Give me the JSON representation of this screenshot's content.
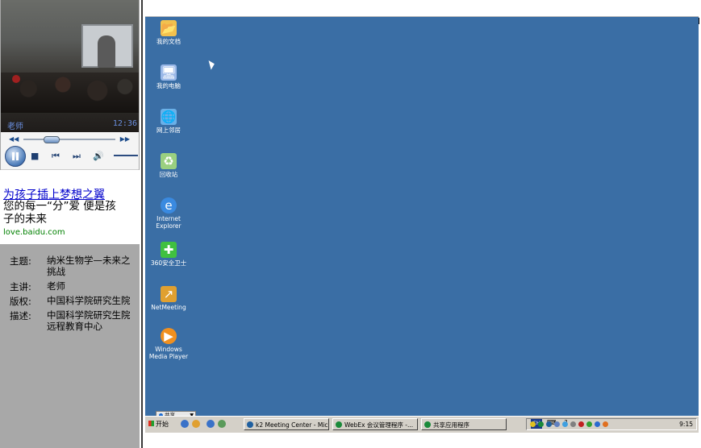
{
  "video": {
    "speaker_label": "老师",
    "time": "12:36"
  },
  "ad": {
    "title": "为孩子插上梦想之翼",
    "desc": "您的每一“分”爱 便是孩子的未来",
    "url": "love.baidu.com"
  },
  "info": [
    {
      "key": "主题:",
      "value": "纳米生物学—未来之挑战"
    },
    {
      "key": "主讲:",
      "value": "老师"
    },
    {
      "key": "版权:",
      "value": "中国科学院研究生院"
    },
    {
      "key": "描述:",
      "value": "中国科学院研究生院远程教育中心"
    }
  ],
  "desktop_icons": [
    {
      "label": "我的文档",
      "icon": "folder-icon",
      "color": "#f2c14e"
    },
    {
      "label": "我的电脑",
      "icon": "computer-icon",
      "color": "#9ab8e8"
    },
    {
      "label": "网上邻居",
      "icon": "network-icon",
      "color": "#6ab0e8"
    },
    {
      "label": "回收站",
      "icon": "recycle-bin-icon",
      "color": "#9ad080"
    },
    {
      "label": "Internet Explorer",
      "icon": "ie-icon",
      "color": "#3a8ae0"
    },
    {
      "label": "360安全卫士",
      "icon": "shield-icon",
      "color": "#40c040"
    },
    {
      "label": "NetMeeting",
      "icon": "netmeeting-icon",
      "color": "#e0a030"
    },
    {
      "label": "Windows Media Player",
      "icon": "media-player-icon",
      "color": "#f09020"
    }
  ],
  "taskbar": {
    "start_label": "开始",
    "buttons": [
      {
        "label": "k2 Meeting Center - Micr..."
      },
      {
        "label": "WebEx 会议管理程序 -..."
      },
      {
        "label": "共享应用程序"
      }
    ],
    "lang": "CH",
    "clock": "9:15"
  },
  "share_popup": "共享"
}
